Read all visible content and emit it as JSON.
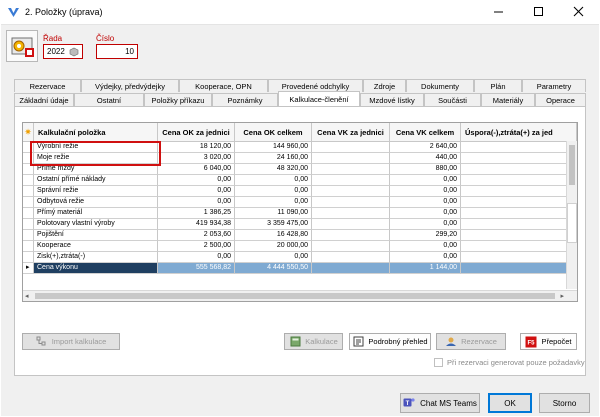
{
  "window": {
    "title": "2. Položky (úprava)"
  },
  "header": {
    "rada_label": "Řada",
    "rada_value": "2022",
    "cislo_label": "Číslo",
    "cislo_value": "10"
  },
  "tabs_row1": [
    "Rezervace",
    "Výdejky, předvýdejky",
    "Kooperace, OPN",
    "Provedené odchylky",
    "Zdroje",
    "Dokumenty",
    "Plán",
    "Parametry"
  ],
  "tabs_row2": [
    "Základní údaje",
    "Ostatní",
    "Položky příkazu",
    "Poznámky",
    "Kalkulace-členění",
    "Mzdové lístky",
    "Součásti",
    "Materiály",
    "Operace"
  ],
  "grid": {
    "columns": [
      "Kalkulační položka",
      "Cena OK za jednici",
      "Cena OK celkem",
      "Cena VK za jednici",
      "Cena VK celkem",
      "Úspora(-),ztráta(+) za jed"
    ],
    "rows": [
      {
        "name": "Výrobní režie",
        "ok_unit": "18 120,00",
        "ok_total": "144 960,00",
        "vk_unit": "",
        "vk_total": "2 640,00",
        "diff": ""
      },
      {
        "name": "Moje režie",
        "ok_unit": "3 020,00",
        "ok_total": "24 160,00",
        "vk_unit": "",
        "vk_total": "440,00",
        "diff": ""
      },
      {
        "name": "Přímé mzdy",
        "ok_unit": "6 040,00",
        "ok_total": "48 320,00",
        "vk_unit": "",
        "vk_total": "880,00",
        "diff": ""
      },
      {
        "name": "Ostatní přímé náklady",
        "ok_unit": "0,00",
        "ok_total": "0,00",
        "vk_unit": "",
        "vk_total": "0,00",
        "diff": ""
      },
      {
        "name": "Správní režie",
        "ok_unit": "0,00",
        "ok_total": "0,00",
        "vk_unit": "",
        "vk_total": "0,00",
        "diff": ""
      },
      {
        "name": "Odbytová režie",
        "ok_unit": "0,00",
        "ok_total": "0,00",
        "vk_unit": "",
        "vk_total": "0,00",
        "diff": ""
      },
      {
        "name": "Přímý materiál",
        "ok_unit": "1 386,25",
        "ok_total": "11 090,00",
        "vk_unit": "",
        "vk_total": "0,00",
        "diff": ""
      },
      {
        "name": "Polotovary vlastní výroby",
        "ok_unit": "419 934,38",
        "ok_total": "3 359 475,00",
        "vk_unit": "",
        "vk_total": "0,00",
        "diff": ""
      },
      {
        "name": "Pojištění",
        "ok_unit": "2 053,60",
        "ok_total": "16 428,80",
        "vk_unit": "",
        "vk_total": "299,20",
        "diff": ""
      },
      {
        "name": "Kooperace",
        "ok_unit": "2 500,00",
        "ok_total": "20 000,00",
        "vk_unit": "",
        "vk_total": "0,00",
        "diff": ""
      },
      {
        "name": "Zisk(+),ztráta(-)",
        "ok_unit": "0,00",
        "ok_total": "0,00",
        "vk_unit": "",
        "vk_total": "0,00",
        "diff": ""
      }
    ],
    "total": {
      "name": "Cena výkonu",
      "ok_unit": "555 568,82",
      "ok_total": "4 444 550,50",
      "vk_unit": "",
      "vk_total": "1 144,00",
      "diff": ""
    }
  },
  "buttons": {
    "import": "Import kalkulace",
    "kalkulace": "Kalkulace",
    "podrobny": "Podrobný přehled",
    "rezervace": "Rezervace",
    "prepocet": "Přepočet"
  },
  "checkbox_label": "Při rezervaci generovat pouze požadavky",
  "footer": {
    "teams": "Chat MS Teams",
    "ok": "OK",
    "storno": "Storno"
  },
  "colors": {
    "highlight": "#d01010",
    "total_row": "#7faad2",
    "total_selected": "#1f3f61"
  }
}
